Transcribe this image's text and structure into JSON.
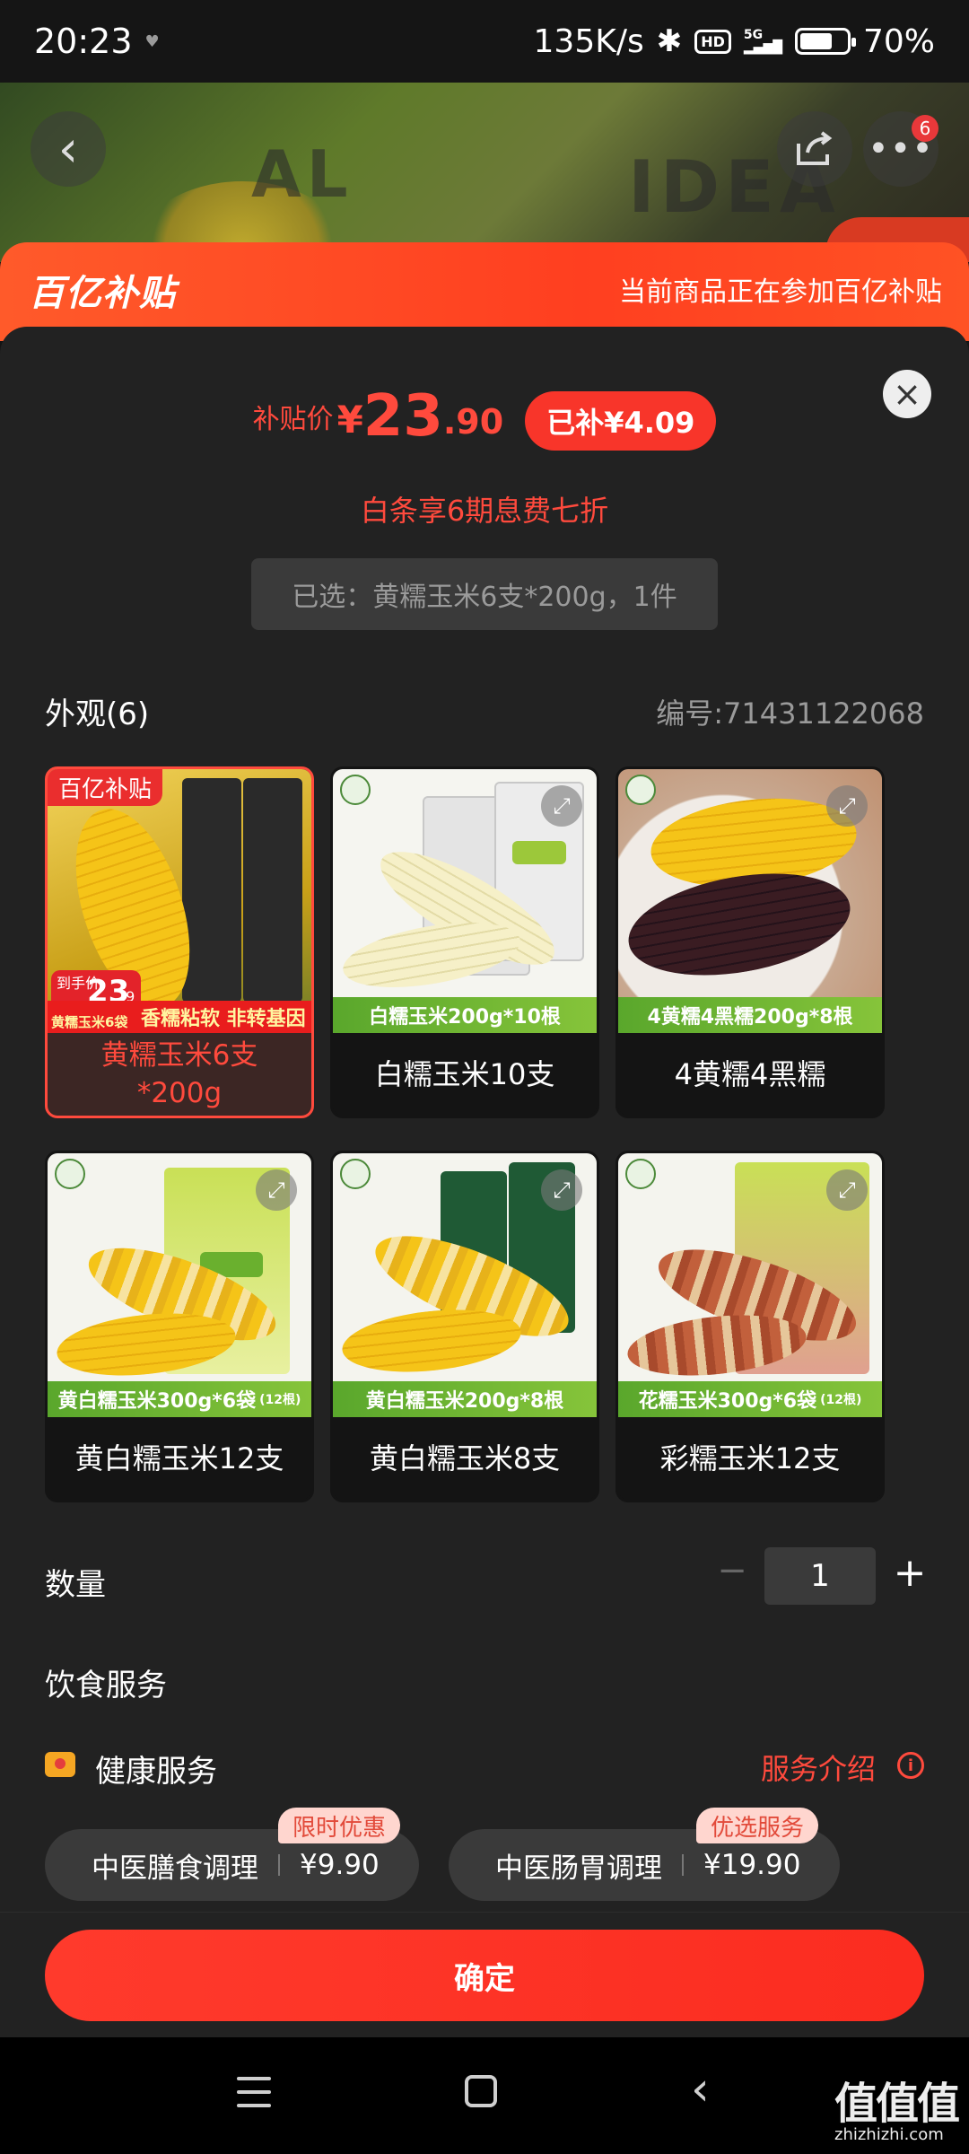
{
  "status_bar": {
    "time": "20:23",
    "net_speed": "135K/s",
    "hd": "HD",
    "network": "5G",
    "battery": "70%",
    "battery_level": 0.7
  },
  "hero": {
    "cart_badge": "6",
    "pack_text_1": "AL",
    "pack_text_2": "IDEA"
  },
  "banner": {
    "logo": "百亿补贴",
    "description": "当前商品正在参加百亿补贴"
  },
  "price": {
    "label": "补贴价",
    "symbol": "¥",
    "integer": "23",
    "decimal": ".90",
    "subsidy": "已补¥4.09"
  },
  "installment_text": "白条享6期息费七折",
  "selected_text": "已选：黄糯玉米6支*200g，1件",
  "appearance": {
    "title": "外观(6)",
    "sku_code": "编号:71431122068"
  },
  "options": [
    {
      "label": "黄糯玉米6支\n*200g",
      "selected": true,
      "tag": "百亿补贴",
      "promo_price": "23",
      "promo_price_dec": ".9",
      "promo_prefix": "到手价",
      "promo_text": "香糯粘软 非转基因",
      "pack_label": "黄糯玉米6袋"
    },
    {
      "label": "白糯玉米10支",
      "strip": "白糯玉米200g*10根"
    },
    {
      "label": "4黄糯4黑糯",
      "strip": "4黄糯4黑糯200g*8根"
    },
    {
      "label": "黄白糯玉米12支",
      "strip": "黄白糯玉米300g*6袋",
      "strip_note": "(12根)"
    },
    {
      "label": "黄白糯玉米8支",
      "strip": "黄白糯玉米200g*8根"
    },
    {
      "label": "彩糯玉米12支",
      "strip": "花糯玉米300g*6袋",
      "strip_note": "(12根)"
    }
  ],
  "quantity": {
    "label": "数量",
    "value": "1",
    "minus": "−",
    "plus": "+"
  },
  "diet_service": {
    "title": "饮食服务",
    "health_title": "健康服务",
    "intro": "服务介绍",
    "services": [
      {
        "name": "中医膳食调理",
        "price": "¥9.90",
        "badge": "限时优惠"
      },
      {
        "name": "中医肠胃调理",
        "price": "¥19.90",
        "badge": "优选服务"
      }
    ]
  },
  "confirm_label": "确定",
  "watermark": {
    "text": "值值值",
    "url": "zhizhizhi.com"
  },
  "colors": {
    "accent": "#ff4a3d",
    "banner": "#ff3f20",
    "sheet_bg": "#222222"
  }
}
